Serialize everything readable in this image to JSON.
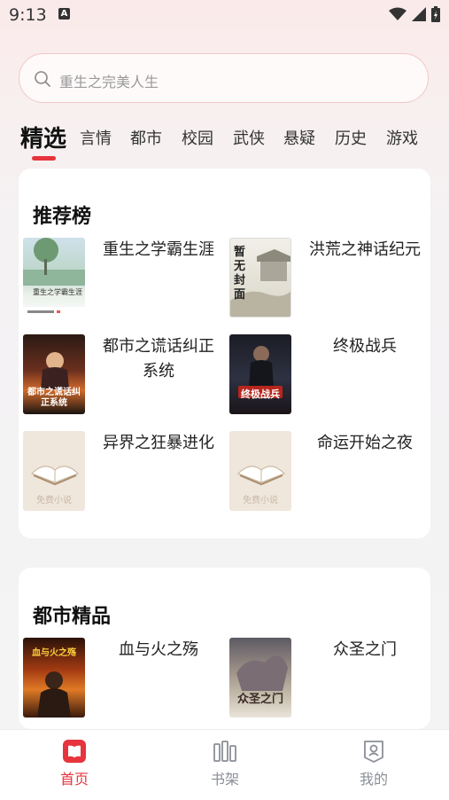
{
  "status": {
    "time": "9:13",
    "indicator": "A"
  },
  "search": {
    "placeholder": "重生之完美人生"
  },
  "tabs": [
    "精选",
    "言情",
    "都市",
    "校园",
    "武侠",
    "悬疑",
    "历史",
    "游戏"
  ],
  "sections": [
    {
      "title": "推荐榜",
      "books": [
        {
          "title": "重生之学霸生涯",
          "cover_text": "重生之学霸生涯"
        },
        {
          "title": "洪荒之神话纪元",
          "cover_text": "暂无封面"
        },
        {
          "title": "都市之谎话纠正系统",
          "cover_text": "都市之谎话纠正系统"
        },
        {
          "title": "终极战兵",
          "cover_text": "终极战兵"
        },
        {
          "title": "异界之狂暴进化",
          "cover_text": "免费小说"
        },
        {
          "title": "命运开始之夜",
          "cover_text": "免费小说"
        }
      ]
    },
    {
      "title": "都市精品",
      "books": [
        {
          "title": "血与火之殇",
          "cover_text": "血与火之殇"
        },
        {
          "title": "众圣之门",
          "cover_text": "众圣之门"
        }
      ]
    }
  ],
  "bottom_nav": [
    {
      "label": "首页",
      "icon": "book-icon"
    },
    {
      "label": "书架",
      "icon": "bookshelf-icon"
    },
    {
      "label": "我的",
      "icon": "profile-icon"
    }
  ],
  "colors": {
    "accent": "#e6353c",
    "inactive": "#8a8f96"
  }
}
